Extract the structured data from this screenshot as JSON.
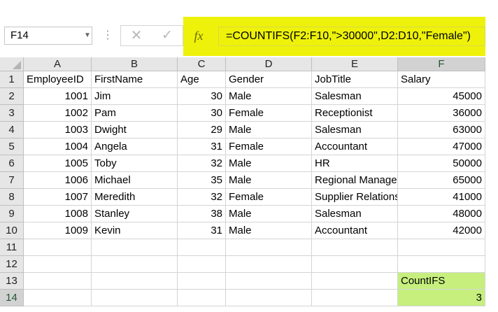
{
  "name_box": {
    "value": "F14"
  },
  "formula_bar": {
    "fx_label": "fx",
    "cancel_icon": "✕",
    "enter_icon": "✓",
    "formula": "=COUNTIFS(F2:F10,\">30000\",D2:D10,\"Female\")",
    "highlight_color": "#eef20a"
  },
  "columns": [
    "A",
    "B",
    "C",
    "D",
    "E",
    "F"
  ],
  "rows": [
    "1",
    "2",
    "3",
    "4",
    "5",
    "6",
    "7",
    "8",
    "9",
    "10",
    "11",
    "12",
    "13",
    "14"
  ],
  "headers": [
    "EmployeeID",
    "FirstName",
    "Age",
    "Gender",
    "JobTitle",
    "Salary"
  ],
  "data": [
    [
      "1001",
      "Jim",
      "30",
      "Male",
      "Salesman",
      "45000"
    ],
    [
      "1002",
      "Pam",
      "30",
      "Female",
      "Receptionist",
      "36000"
    ],
    [
      "1003",
      "Dwight",
      "29",
      "Male",
      "Salesman",
      "63000"
    ],
    [
      "1004",
      "Angela",
      "31",
      "Female",
      "Accountant",
      "47000"
    ],
    [
      "1005",
      "Toby",
      "32",
      "Male",
      "HR",
      "50000"
    ],
    [
      "1006",
      "Michael",
      "35",
      "Male",
      "Regional Manager",
      "65000"
    ],
    [
      "1007",
      "Meredith",
      "32",
      "Female",
      "Supplier Relations",
      "41000"
    ],
    [
      "1008",
      "Stanley",
      "38",
      "Male",
      "Salesman",
      "48000"
    ],
    [
      "1009",
      "Kevin",
      "31",
      "Male",
      "Accountant",
      "42000"
    ]
  ],
  "result": {
    "label": "CountIFS",
    "value": "3",
    "highlight_color": "#c6ef7e"
  }
}
